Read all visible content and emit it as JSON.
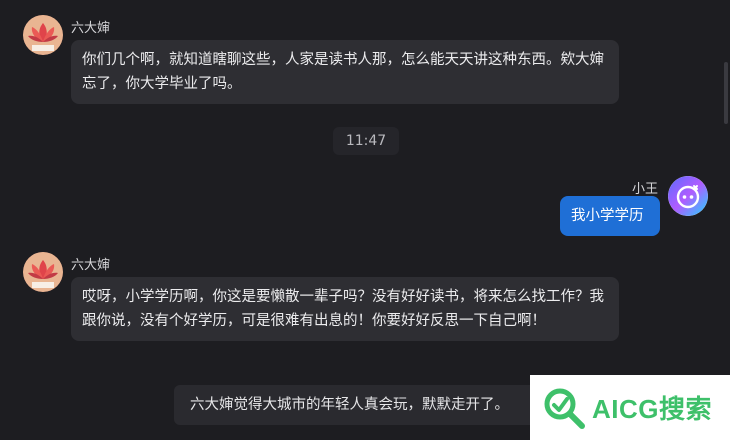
{
  "messages": [
    {
      "sender": "六大婶",
      "text": "你们几个啊，就知道瞎聊这些，人家是读书人那，怎么能天天讲这种东西。欸大婶忘了，你大学毕业了吗。"
    },
    {
      "timestamp": "11:47"
    },
    {
      "sender": "小王",
      "text": "我小学学历"
    },
    {
      "sender": "六大婶",
      "text": "哎呀，小学学历啊，你这是要懒散一辈子吗？没有好好读书，将来怎么找工作？我跟你说，没有个好学历，可是很难有出息的！你要好好反思一下自己啊！"
    }
  ],
  "system_notice": "六大婶觉得大城市的年轻人真会玩，默默走开了。",
  "watermark": {
    "text": "AICG搜索",
    "color": "#3ec06a"
  },
  "colors": {
    "background": "#1d1d21",
    "bubble": "#2e2e33",
    "my_bubble": "#1f6fd6"
  },
  "icons": {
    "aunt_avatar": "lotus-avatar-icon",
    "user_avatar": "ai-assistant-icon",
    "watermark_logo": "magnifier-logo-icon"
  }
}
